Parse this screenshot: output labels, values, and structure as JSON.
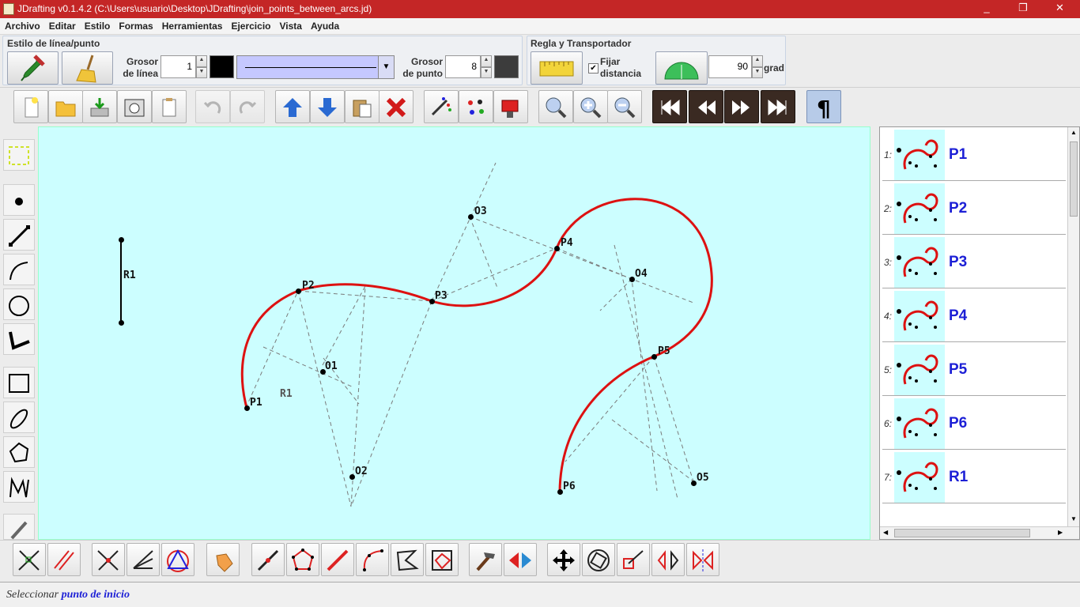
{
  "window": {
    "title": "JDrafting  v0.1.4.2 (C:\\Users\\usuario\\Desktop\\JDrafting\\join_points_between_arcs.jd)",
    "minimize": "_",
    "maximize": "❐",
    "close": "✕"
  },
  "menu": [
    "Archivo",
    "Editar",
    "Estilo",
    "Formas",
    "Herramientas",
    "Ejercicio",
    "Vista",
    "Ayuda"
  ],
  "style_group": {
    "title": "Estilo de línea/punto",
    "line_width_label_1": "Grosor",
    "line_width_label_2": "de línea",
    "line_width_value": "1",
    "point_size_label_1": "Grosor",
    "point_size_label_2": "de punto",
    "point_size_value": "8",
    "line_color": "#000000",
    "point_color": "#3c3c3c",
    "pattern_bg": "#c5c8ff"
  },
  "ruler_group": {
    "title": "Regla y Transportador",
    "fix_distance_1": "Fijar",
    "fix_distance_2": "distancia",
    "fix_checked": "✔",
    "angle_value": "90",
    "angle_unit": "grad"
  },
  "canvas": {
    "bg": "#ccfeff",
    "arc_color": "#dd1111",
    "point_labels": [
      "R1",
      "P2",
      "O3",
      "P4",
      "O4",
      "P3",
      "O1",
      "R1",
      "P1",
      "P5",
      "O2",
      "O5",
      "P6"
    ]
  },
  "figures": [
    {
      "num": "1:",
      "name": "P1"
    },
    {
      "num": "2:",
      "name": "P2"
    },
    {
      "num": "3:",
      "name": "P3"
    },
    {
      "num": "4:",
      "name": "P4"
    },
    {
      "num": "5:",
      "name": "P5"
    },
    {
      "num": "6:",
      "name": "P6"
    },
    {
      "num": "7:",
      "name": "R1"
    }
  ],
  "status": {
    "prefix": "Seleccionar ",
    "highlight": "punto de inicio"
  }
}
